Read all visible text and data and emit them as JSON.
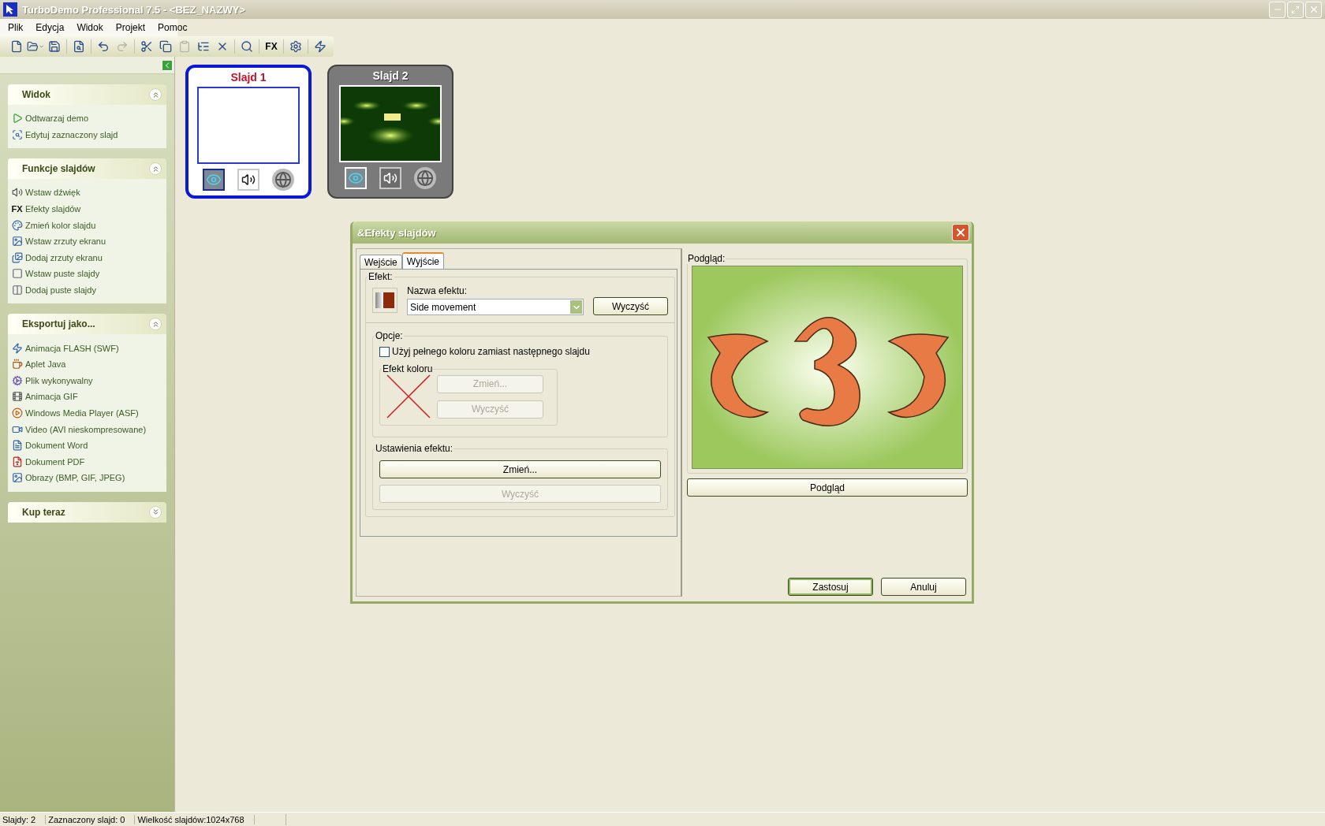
{
  "window": {
    "title": "TurboDemo Professional 7.5 - <BEZ_NAZWY>"
  },
  "menu": [
    {
      "label": "Plik"
    },
    {
      "label": "Edycja"
    },
    {
      "label": "Widok"
    },
    {
      "label": "Projekt"
    },
    {
      "label": "Pomoc"
    }
  ],
  "toolbar": [
    {
      "kind": "new",
      "disabled": false
    },
    {
      "kind": "open",
      "disabled": false
    },
    {
      "kind": "save",
      "disabled": false
    },
    {
      "kind": "sep"
    },
    {
      "kind": "preview",
      "disabled": false
    },
    {
      "kind": "sep"
    },
    {
      "kind": "undo",
      "disabled": false
    },
    {
      "kind": "redo",
      "disabled": true
    },
    {
      "kind": "sep"
    },
    {
      "kind": "cut",
      "disabled": false
    },
    {
      "kind": "copy",
      "disabled": false
    },
    {
      "kind": "paste",
      "disabled": true
    },
    {
      "kind": "arrange",
      "disabled": false
    },
    {
      "kind": "delete",
      "disabled": false
    },
    {
      "kind": "sep"
    },
    {
      "kind": "find",
      "disabled": false
    },
    {
      "kind": "sep"
    },
    {
      "kind": "text",
      "label": "FX",
      "disabled": false
    },
    {
      "kind": "sep"
    },
    {
      "kind": "settings",
      "disabled": false
    },
    {
      "kind": "sep"
    },
    {
      "kind": "lightning",
      "disabled": false
    }
  ],
  "sidebar": {
    "panels": [
      {
        "title": "Widok",
        "expanded": true,
        "items": [
          {
            "kind": "play",
            "label": "Odtwarzaj demo"
          },
          {
            "kind": "edit",
            "label": "Edytuj zaznaczony slajd"
          }
        ]
      },
      {
        "title": "Funkcje slajdów",
        "expanded": true,
        "items": [
          {
            "kind": "sound",
            "label": "Wstaw dźwięk"
          },
          {
            "kind": "text",
            "icon_text": "FX",
            "label": "Efekty slajdów"
          },
          {
            "kind": "color",
            "label": "Zmień kolor slajdu"
          },
          {
            "kind": "screen",
            "label": "Wstaw zrzuty ekranu"
          },
          {
            "kind": "screens",
            "label": "Dodaj zrzuty ekranu"
          },
          {
            "kind": "blank",
            "label": "Wstaw puste slajdy"
          },
          {
            "kind": "blanks",
            "label": "Dodaj puste slajdy"
          }
        ]
      },
      {
        "title": "Eksportuj jako...",
        "expanded": true,
        "items": [
          {
            "kind": "flash",
            "label": "Animacja FLASH (SWF)"
          },
          {
            "kind": "java",
            "label": "Aplet Java"
          },
          {
            "kind": "exe",
            "label": "Plik wykonywalny"
          },
          {
            "kind": "gif",
            "label": "Animacja GIF"
          },
          {
            "kind": "media",
            "label": "Windows Media Player (ASF)"
          },
          {
            "kind": "video",
            "label": "Video (AVI nieskompresowane)"
          },
          {
            "kind": "word",
            "label": "Dokument Word"
          },
          {
            "kind": "pdf",
            "label": "Dokument PDF"
          },
          {
            "kind": "image",
            "label": "Obrazy (BMP, GIF, JPEG)"
          }
        ]
      },
      {
        "title": "Kup teraz",
        "expanded": false
      }
    ]
  },
  "slides": [
    {
      "title": "Slajd 1",
      "selected": true,
      "kind": "blank"
    },
    {
      "title": "Slajd 2",
      "selected": false,
      "kind": "photo"
    }
  ],
  "dialog": {
    "title": "&Efekty slajdów",
    "tabs": [
      {
        "label": "Wejście",
        "selected": false
      },
      {
        "label": "Wyjście",
        "selected": true
      }
    ],
    "effect_group": "Efekt:",
    "effect_name_label": "Nazwa efektu:",
    "effect_name": "Side movement",
    "clear_button": {
      "label": "Wyczyść",
      "disabled": false
    },
    "options_group": "Opcje:",
    "full_color": {
      "label": "Użyj pełnego koloru zamiast następnego slajdu",
      "checked": false
    },
    "color_group": "Efekt koloru",
    "color_buttons": [
      {
        "label": "Zmień...",
        "disabled": true
      },
      {
        "label": "Wyczyść",
        "disabled": true
      }
    ],
    "settings_group": "Ustawienia efektu:",
    "settings_buttons": [
      {
        "label": "Zmień...",
        "disabled": false
      },
      {
        "label": "Wyczyść",
        "disabled": true
      }
    ],
    "preview_group": "Podgląd:",
    "preview_button": "Podgląd",
    "buttons": [
      {
        "label": "Zastosuj",
        "default": true
      },
      {
        "label": "Anuluj",
        "default": false
      }
    ]
  },
  "status_bar": [
    "Slajdy: 2",
    "Zaznaczony slajd: 0",
    "Wielkość slajdów:1024x768"
  ]
}
